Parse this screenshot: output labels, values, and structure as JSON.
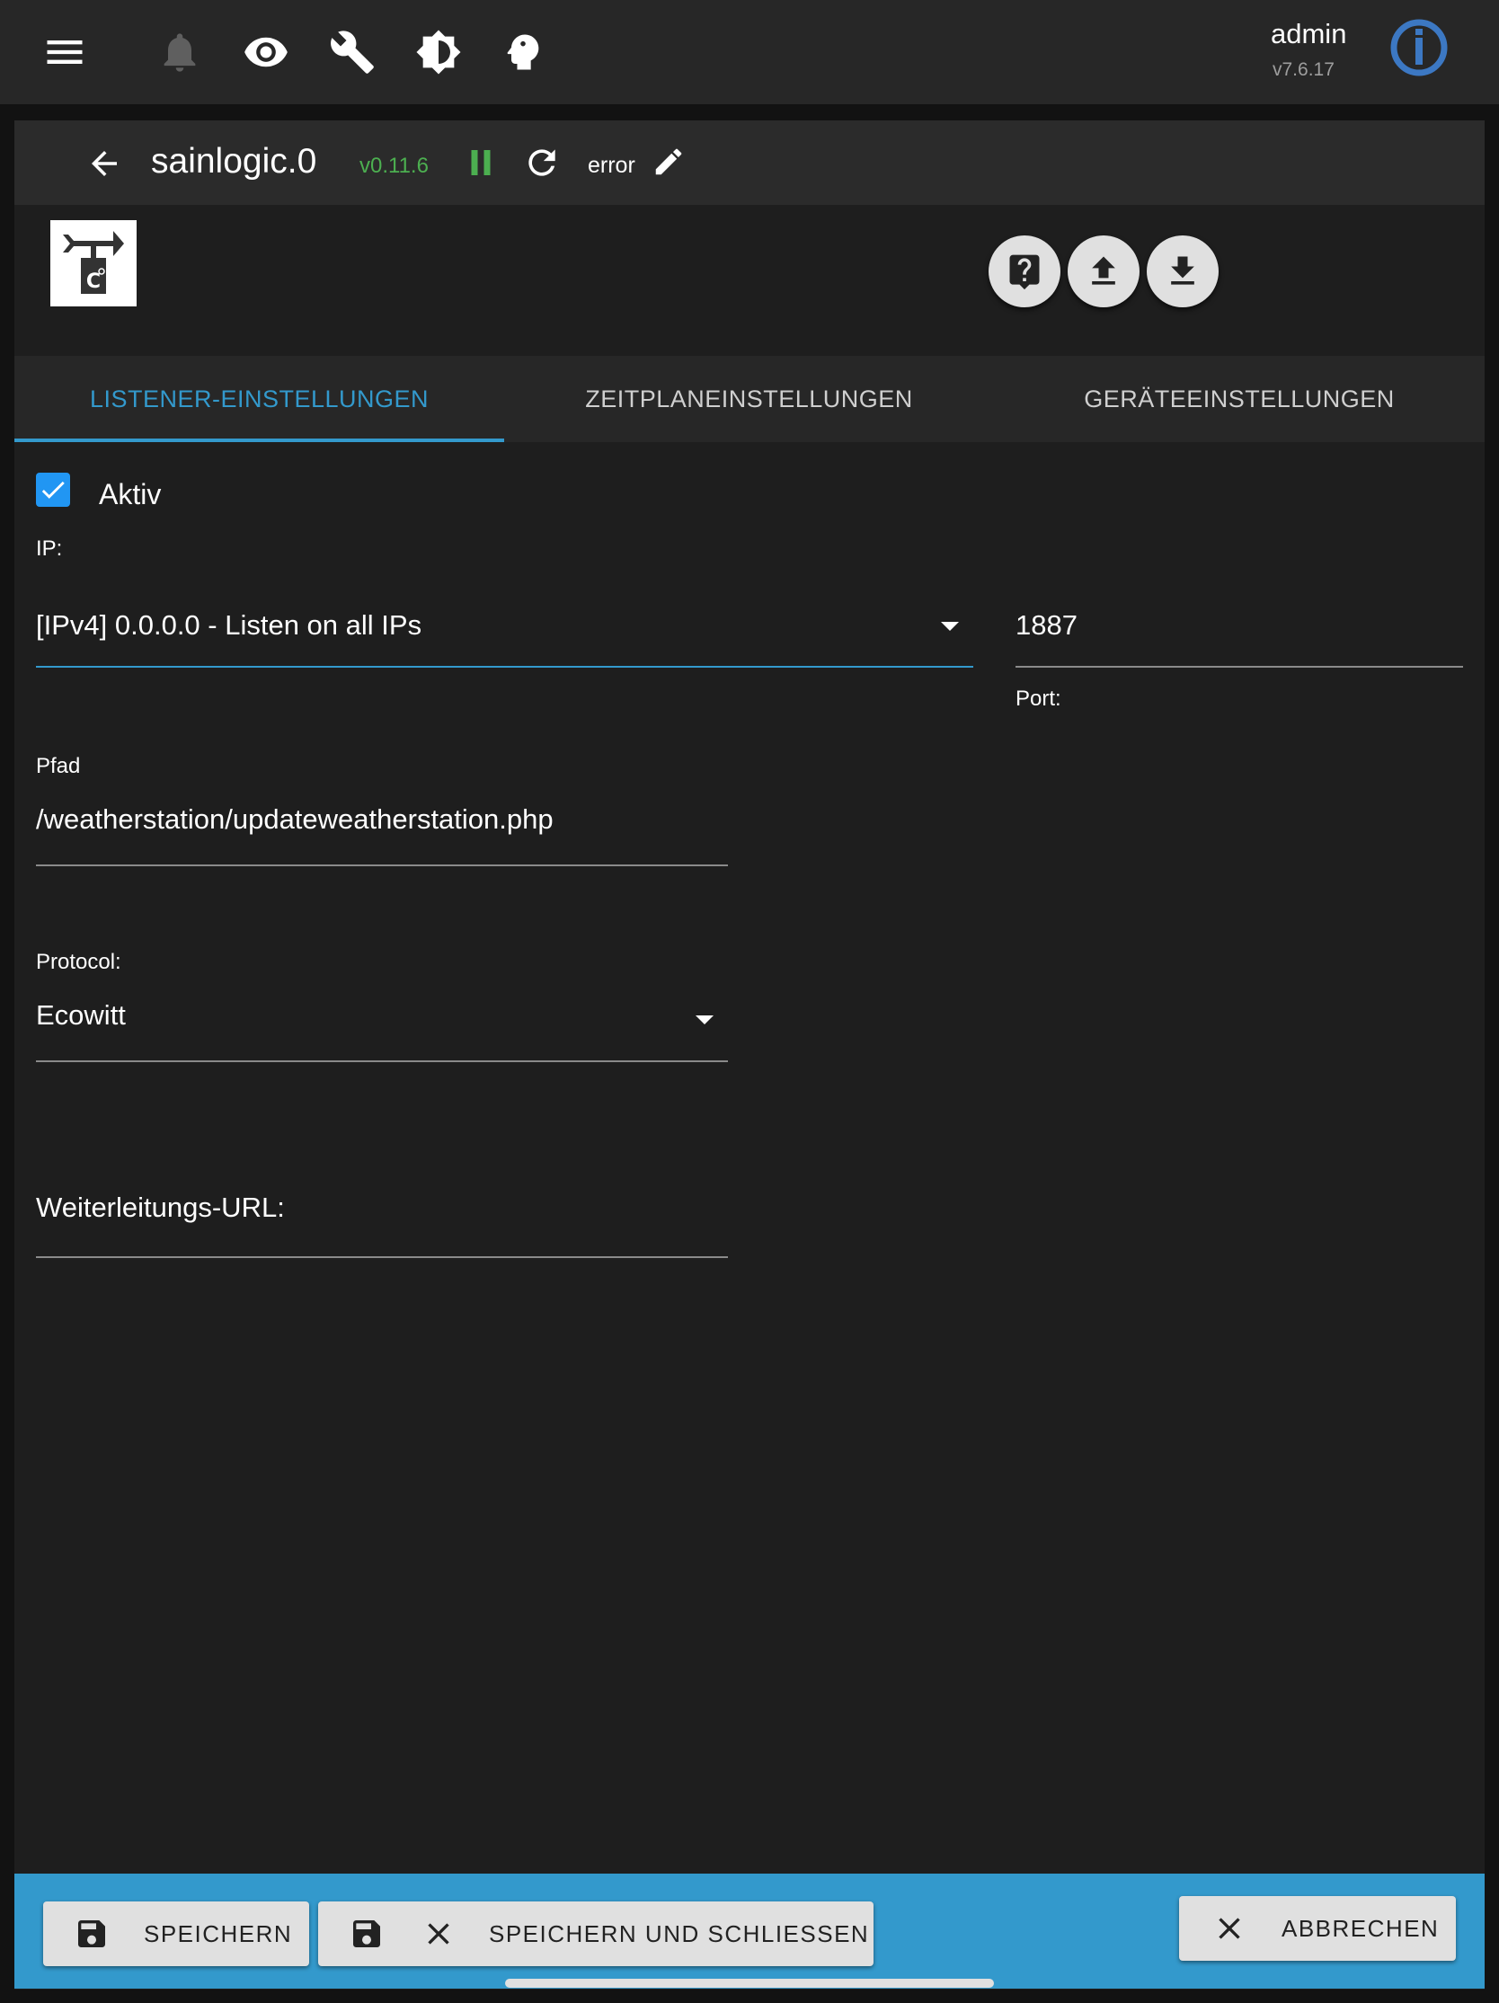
{
  "appbar": {
    "icons": [
      "menu-icon",
      "bell-icon",
      "eye-icon",
      "wrench-icon",
      "brightness-icon",
      "expert-mode-icon"
    ],
    "user": "admin",
    "version": "v7.6.17"
  },
  "instance": {
    "name": "sainlogic.0",
    "version": "v0.11.6",
    "status": "error"
  },
  "tabs": [
    {
      "label": "LISTENER-EINSTELLUNGEN",
      "active": true
    },
    {
      "label": "ZEITPLANEINSTELLUNGEN",
      "active": false
    },
    {
      "label": "GERÄTEEINSTELLUNGEN",
      "active": false
    }
  ],
  "form": {
    "active_label": "Aktiv",
    "active_checked": true,
    "ip_label": "IP:",
    "ip_value": "[IPv4] 0.0.0.0 - Listen on all IPs",
    "port_value": "1887",
    "port_label": "Port:",
    "path_label": "Pfad",
    "path_value": "/weatherstation/updateweatherstation.php",
    "protocol_label": "Protocol:",
    "protocol_value": "Ecowitt",
    "forward_label": "Weiterleitungs-URL:"
  },
  "footer": {
    "save": "SPEICHERN",
    "save_close": "SPEICHERN UND SCHLIESSEN",
    "cancel": "ABBRECHEN"
  },
  "colors": {
    "accent": "#3399cc",
    "checkbox": "#2196f3",
    "running": "#4caf50"
  }
}
